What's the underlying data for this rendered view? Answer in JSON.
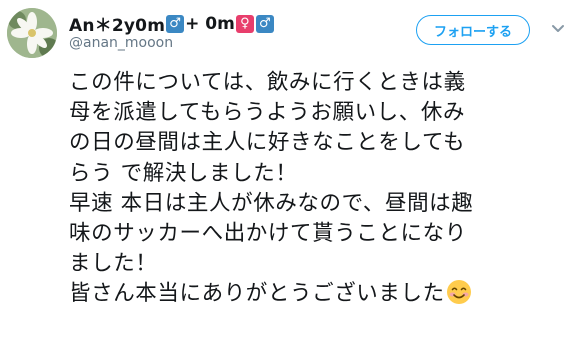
{
  "user": {
    "name_prefix": "An＊2y0m",
    "male_symbol": "♂",
    "name_mid": "+ 0m",
    "female_symbol": "♀",
    "male_symbol_2": "♂",
    "handle": "@anan_mooon",
    "avatar": "flower-photo"
  },
  "actions": {
    "follow_label": "フォローする",
    "more_icon": "chevron-down-icon"
  },
  "tweet": {
    "lines": [
      "この件については、飲みに行くときは義",
      "母を派遣してもらうようお願いし、休み",
      "の日の昼間は主人に好きなことをしても",
      "らう で解決しました！",
      "早速 本日は主人が休みなので、昼間は趣",
      "味のサッカーへ出かけて貰うことになり",
      "ました！",
      "皆さん本当にありがとうございました"
    ],
    "end_emoji": "smiling-face-icon"
  },
  "colors": {
    "accent": "#1da1f2",
    "male": "#3b88c3",
    "female": "#e83e6c",
    "text": "#14171a",
    "muted": "#657786"
  }
}
